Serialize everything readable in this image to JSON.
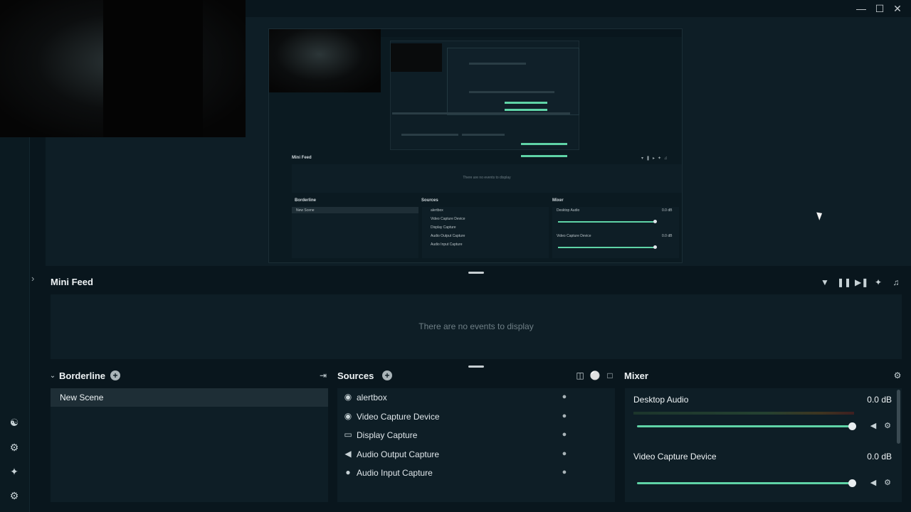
{
  "window": {
    "minimize_icon": "minimize-icon",
    "maximize_icon": "maximize-icon",
    "close_icon": "close-icon"
  },
  "left_nav": {
    "items": [
      {
        "name": "themes-icon"
      },
      {
        "name": "app-store-icon"
      },
      {
        "name": "highlighter-icon"
      },
      {
        "name": "settings-icon"
      }
    ]
  },
  "nested_preview": {
    "mini_feed_title": "Mini Feed",
    "empty_text": "There are no events to display",
    "scenes_title": "Borderline",
    "scene": "New Scene",
    "sources_title": "Sources",
    "sources": [
      "alertbox",
      "Video Capture Device",
      "Display Capture",
      "Audio Output Capture",
      "Audio Input Capture"
    ],
    "mixer_title": "Mixer",
    "mixer": [
      {
        "name": "Desktop Audio",
        "db": "0.0 dB"
      },
      {
        "name": "Video Capture Device",
        "db": "0.0 dB"
      }
    ]
  },
  "mini_feed": {
    "title": "Mini Feed",
    "empty_text": "There are no events to display",
    "icons": [
      "filter-icon",
      "pause-icon",
      "skip-icon",
      "mute-alerts-icon",
      "volume-icon"
    ]
  },
  "scenes": {
    "title": "Borderline",
    "items": [
      "New Scene"
    ]
  },
  "sources": {
    "title": "Sources",
    "items": [
      {
        "label": "alertbox",
        "icon": "globe-icon"
      },
      {
        "label": "Video Capture Device",
        "icon": "webcam-icon"
      },
      {
        "label": "Display Capture",
        "icon": "monitor-icon"
      },
      {
        "label": "Audio Output Capture",
        "icon": "speaker-icon"
      },
      {
        "label": "Audio Input Capture",
        "icon": "microphone-icon"
      }
    ]
  },
  "mixer": {
    "title": "Mixer",
    "channels": [
      {
        "name": "Desktop Audio",
        "db": "0.0 dB",
        "volume": 1.0
      },
      {
        "name": "Video Capture Device",
        "db": "0.0 dB",
        "volume": 1.0
      }
    ]
  },
  "colors": {
    "background": "#09161d",
    "panel": "#0e1e26",
    "accent": "#5fd3a6",
    "selected_row": "#1e2e36"
  }
}
